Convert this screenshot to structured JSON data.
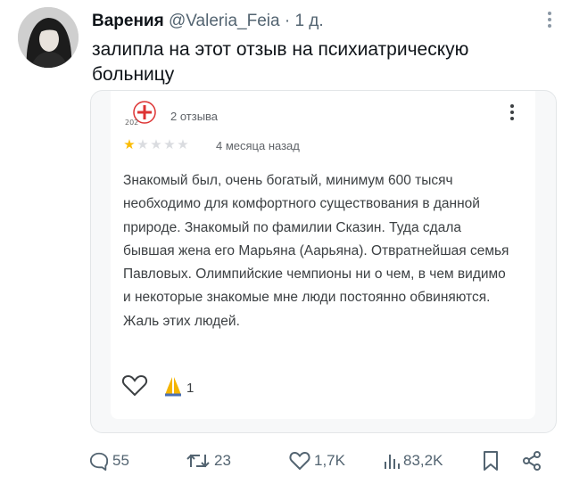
{
  "tweet": {
    "author_name": "Варения",
    "author_handle": "@Valeria_Feia",
    "separator": "·",
    "time": "1 д.",
    "text": "залипла на этот отзыв на психиатрическую больницу"
  },
  "review": {
    "count_label": "2 отзыва",
    "rating": 1,
    "max_rating": 5,
    "date": "4 месяца назад",
    "text": "Знакомый был, очень богатый, минимум 600 тысяч необходимо для комфортного существования в данной природе. Знакомый по фамилии Сказин. Туда сдала бывшая жена его Марьяна (Аарьяна). Отвратнейшая семья Павловых. Олимпийские чемпионы ни о чем, в чем видимо и некоторые знакомые мне люди постоянно обвиняются. Жаль этих людей.",
    "like_count": "1"
  },
  "actions": {
    "replies": "55",
    "retweets": "23",
    "likes": "1,7K",
    "views": "83,2K"
  },
  "colors": {
    "text": "#0f1419",
    "muted": "#536471",
    "star_on": "#fbbc04",
    "star_off": "#dadce0",
    "review_text": "#3c4043"
  }
}
